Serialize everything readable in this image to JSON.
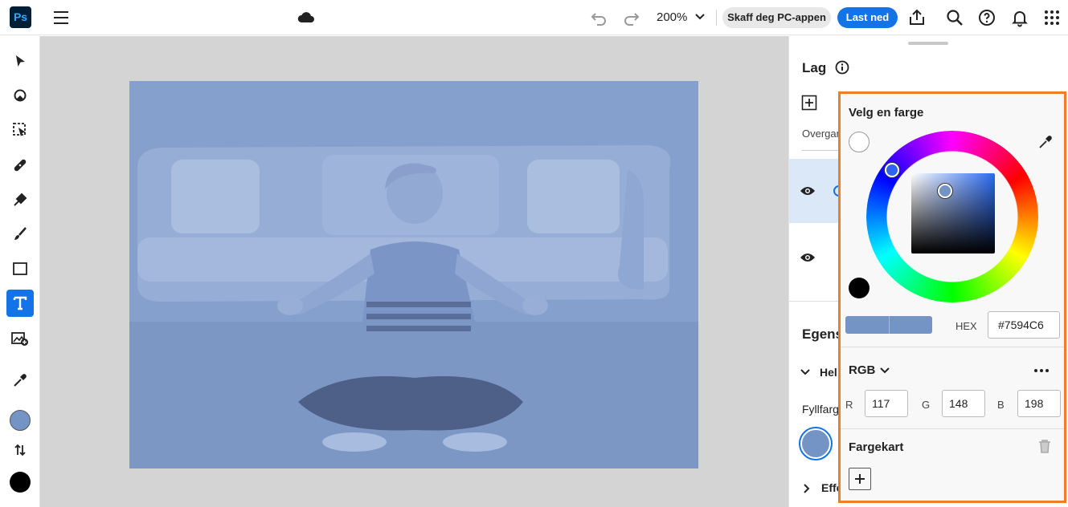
{
  "app": {
    "logo": "Ps",
    "accent": "#1473e6",
    "highlight_border": "#f07d28"
  },
  "topbar": {
    "zoom": "200%",
    "get_app_label": "Skaff deg PC-appen",
    "download_label": "Last ned",
    "icons": [
      "menu-icon",
      "cloud-icon",
      "undo-icon",
      "redo-icon",
      "share-icon",
      "search-icon",
      "help-icon",
      "bell-icon",
      "apps-grid-icon"
    ]
  },
  "tools": [
    "select-tool-icon",
    "adjust-tool-icon",
    "object-select-tool-icon",
    "heal-tool-icon",
    "quick-action-tool-icon",
    "brush-tool-icon",
    "rectangle-tool-icon",
    "text-tool-icon",
    "add-image-tool-icon",
    "eyedropper-tool-icon"
  ],
  "colors": {
    "foreground": "#7594C6",
    "background": "#000000"
  },
  "layers_panel": {
    "title": "Lag",
    "blend_label": "Overgan"
  },
  "properties_panel": {
    "title": "Egens",
    "section_label": "Hel",
    "fill_label": "Fyllfarg",
    "effects_label": "Effe"
  },
  "color_picker": {
    "title": "Velg en farge",
    "hex_label": "HEX",
    "hex_value": "#7594C6",
    "mode": "RGB",
    "channels": [
      {
        "label": "R",
        "value": "117"
      },
      {
        "label": "G",
        "value": "148"
      },
      {
        "label": "B",
        "value": "198"
      }
    ],
    "swatches_title": "Fargekart"
  }
}
